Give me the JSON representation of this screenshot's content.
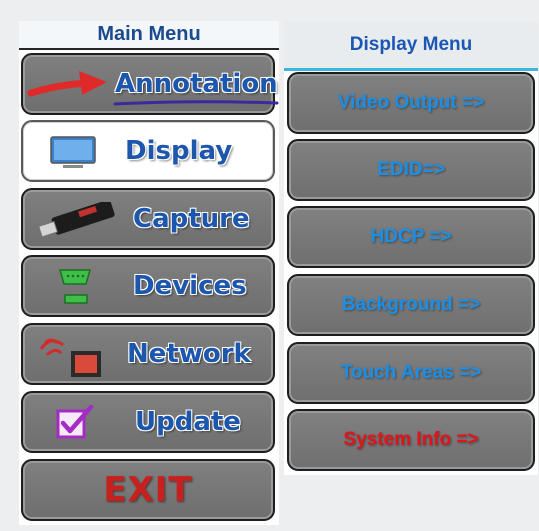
{
  "main_menu": {
    "title": "Main Menu",
    "items": [
      {
        "label": "Annotation",
        "icon": "red-arrow-icon"
      },
      {
        "label": "Display",
        "icon": "monitor-icon",
        "active": true
      },
      {
        "label": "Capture",
        "icon": "usb-stick-icon"
      },
      {
        "label": "Devices",
        "icon": "serial-port-icon"
      },
      {
        "label": "Network",
        "icon": "network-port-icon"
      },
      {
        "label": "Update",
        "icon": "checkbox-icon"
      },
      {
        "label": "EXIT"
      }
    ]
  },
  "display_menu": {
    "title": "Display Menu",
    "items": [
      {
        "label": "Video Output =>"
      },
      {
        "label": "EDID=>"
      },
      {
        "label": "HDCP =>"
      },
      {
        "label": "Background =>"
      },
      {
        "label": "Touch Areas =>"
      },
      {
        "label": "System Info =>"
      }
    ]
  },
  "colors": {
    "menu_text_blue": "#1d57ad",
    "submenu_text_blue": "#1b8fe6",
    "exit_red": "#c8201e",
    "system_info_red": "#e0141a",
    "header_accent": "#3ab7dc",
    "button_gray": "#777777"
  }
}
